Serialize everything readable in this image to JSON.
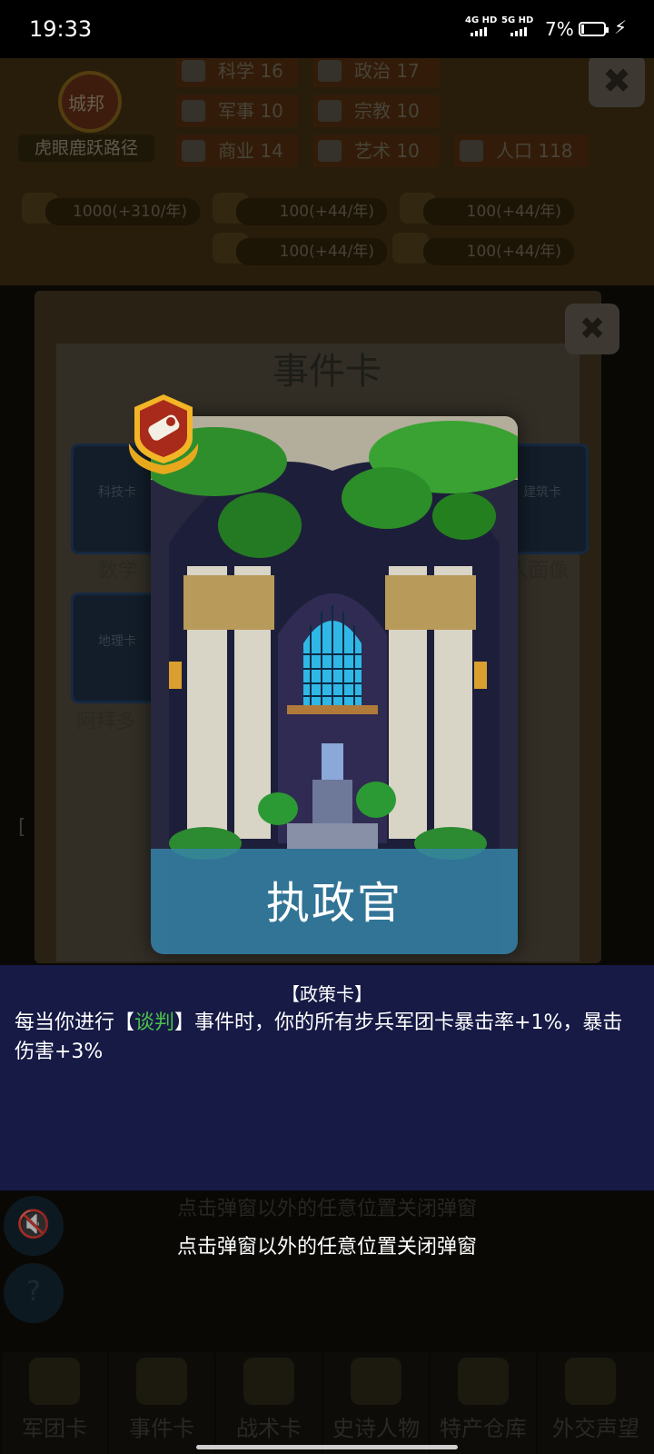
{
  "status_bar": {
    "time": "19:33",
    "net1": "4G HD",
    "net2": "5G HD",
    "battery": "7%"
  },
  "city": {
    "type": "城邦",
    "name": "虎眼鹿跃路径"
  },
  "stats": [
    {
      "label": "科学",
      "value": "16"
    },
    {
      "label": "政治",
      "value": "17"
    },
    {
      "label": "军事",
      "value": "10"
    },
    {
      "label": "宗教",
      "value": "10"
    },
    {
      "label": "商业",
      "value": "14"
    },
    {
      "label": "艺术",
      "value": "10"
    },
    {
      "label": "人口",
      "value": "118"
    }
  ],
  "resources": [
    "1000(+310/年)",
    "100(+44/年)",
    "100(+44/年)",
    "100(+44/年)",
    "100(+44/年)"
  ],
  "panel": {
    "title": "事件卡",
    "card_labels": [
      "科技卡",
      "建筑卡",
      "地理卡"
    ],
    "item_labels": [
      "数学",
      "人面像",
      "阿拜多"
    ],
    "inner_marker": "["
  },
  "event_card": {
    "name": "执政官",
    "type": "【政策卡】",
    "desc_before": "每当你进行【",
    "keyword": "谈判",
    "desc_after": "】事件时，你的所有步兵军团卡暴击率+1%，暴击伤害+3%"
  },
  "close_hint": "点击弹窗以外的任意位置关闭弹窗",
  "bottom_tabs": [
    "军团卡",
    "事件卡",
    "战术卡",
    "史诗人物",
    "特产仓库",
    "外交声望"
  ],
  "colors": {
    "keyword": "#4bc24b",
    "desc_panel": "#161a45",
    "card_banner": "#3684a8"
  }
}
